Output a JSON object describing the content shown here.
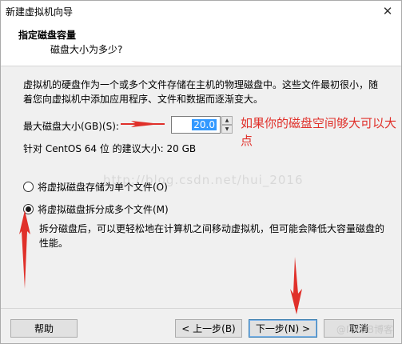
{
  "window": {
    "title": "新建虚拟机向导",
    "close_label": "✕"
  },
  "header": {
    "title": "指定磁盘容量",
    "subtitle": "磁盘大小为多少?"
  },
  "body": {
    "description": "虚拟机的硬盘作为一个或多个文件存储在主机的物理磁盘中。这些文件最初很小，随着您向虚拟机中添加应用程序、文件和数据而逐渐变大。",
    "max_size_label": "最大磁盘大小(GB)(S):",
    "max_size_value": "20.0",
    "recommend_text": "针对 CentOS 64 位 的建议大小: 20 GB",
    "annotation": "如果你的磁盘空间够大可以大点",
    "watermark": "http://blog.csdn.net/hui_2016"
  },
  "options": {
    "single_file": {
      "label": "将虚拟磁盘存储为单个文件(O)",
      "selected": false
    },
    "split_files": {
      "label": "将虚拟磁盘拆分成多个文件(M)",
      "selected": true
    },
    "split_description": "拆分磁盘后，可以更轻松地在计算机之间移动虚拟机，但可能会降低大容量磁盘的性能。"
  },
  "footer": {
    "help": "帮助",
    "back": "< 上一步(B)",
    "next": "下一步(N) >",
    "cancel": "取消",
    "watermark": "@ITPUB博客"
  },
  "colors": {
    "annotation": "#e0302a",
    "selection": "#3399ff"
  }
}
